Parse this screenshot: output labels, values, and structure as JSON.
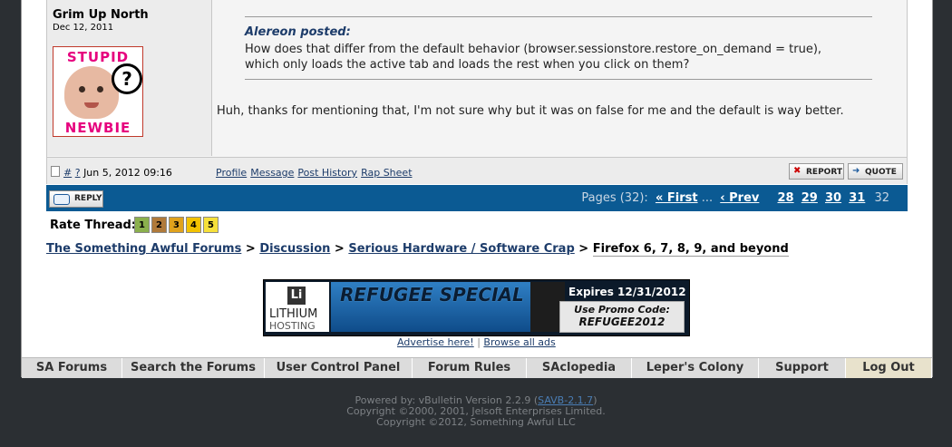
{
  "post": {
    "username": "Grim Up North",
    "regdate": "Dec 12, 2011",
    "avatar": {
      "top_text": "STUPID",
      "bottom_text": "NEWBIE",
      "mark": "?"
    },
    "quote_author": "Alereon posted:",
    "quote_lines": [
      "How does that differ from the default behavior (browser.sessionstore.restore_on_demand = true),",
      "which only loads the active tab and loads the rest when you click on them?"
    ],
    "body": "Huh, thanks for mentioning that, I'm not sure why but it was on false for me and the default is way better.",
    "hash": "#",
    "question": "?",
    "datetime": "Jun 5, 2012 09:16",
    "profile_links": [
      "Profile",
      "Message",
      "Post History",
      "Rap Sheet"
    ],
    "report_label": "REPORT",
    "quote_label": "QUOTE"
  },
  "threadbar": {
    "reply_label": "REPLY",
    "pages_label": "Pages (32):",
    "first": "« First",
    "ellipsis": "...",
    "prev": "‹ Prev",
    "pages": [
      "28",
      "29",
      "30",
      "31"
    ],
    "current": "32"
  },
  "rate": {
    "label": "Rate Thread:",
    "stars": [
      {
        "label": "1",
        "color": "#8bb04d"
      },
      {
        "label": "2",
        "color": "#b07a3a"
      },
      {
        "label": "3",
        "color": "#e0a21d"
      },
      {
        "label": "4",
        "color": "#f2c200"
      },
      {
        "label": "5",
        "color": "#f6e03a"
      }
    ]
  },
  "breadcrumb": {
    "items": [
      "The Something Awful Forums",
      "Discussion",
      "Serious Hardware / Software Crap"
    ],
    "separator": ">",
    "current": "Firefox 6, 7, 8, 9, and beyond"
  },
  "ad": {
    "logo_letter": "Li",
    "logo_name": "LITHIUM",
    "logo_sub": "HOSTING",
    "headline": "REFUGEE SPECIAL",
    "expires": "Expires 12/31/2012",
    "promo_line1": "Use Promo Code:",
    "promo_line2": "REFUGEE2012",
    "advertise": "Advertise here!",
    "sep": "|",
    "browse": "Browse all ads"
  },
  "nav": {
    "items": [
      "SA Forums",
      "Search the Forums",
      "User Control Panel",
      "Forum Rules",
      "SAclopedia",
      "Leper's Colony",
      "Support",
      "Log Out"
    ]
  },
  "footer": {
    "powered": "Powered by: vBulletin Version 2.2.9",
    "savb": "SAVB-2.1.7",
    "line2": "Copyright ©2000, 2001, Jelsoft Enterprises Limited.",
    "line3": "Copyright ©2012, Something Awful LLC"
  },
  "colors": {
    "threadbar": "#0b5a93",
    "link": "#1d3c6a",
    "background": "#2b2f33",
    "logout_bg": "#e8e2cc"
  }
}
